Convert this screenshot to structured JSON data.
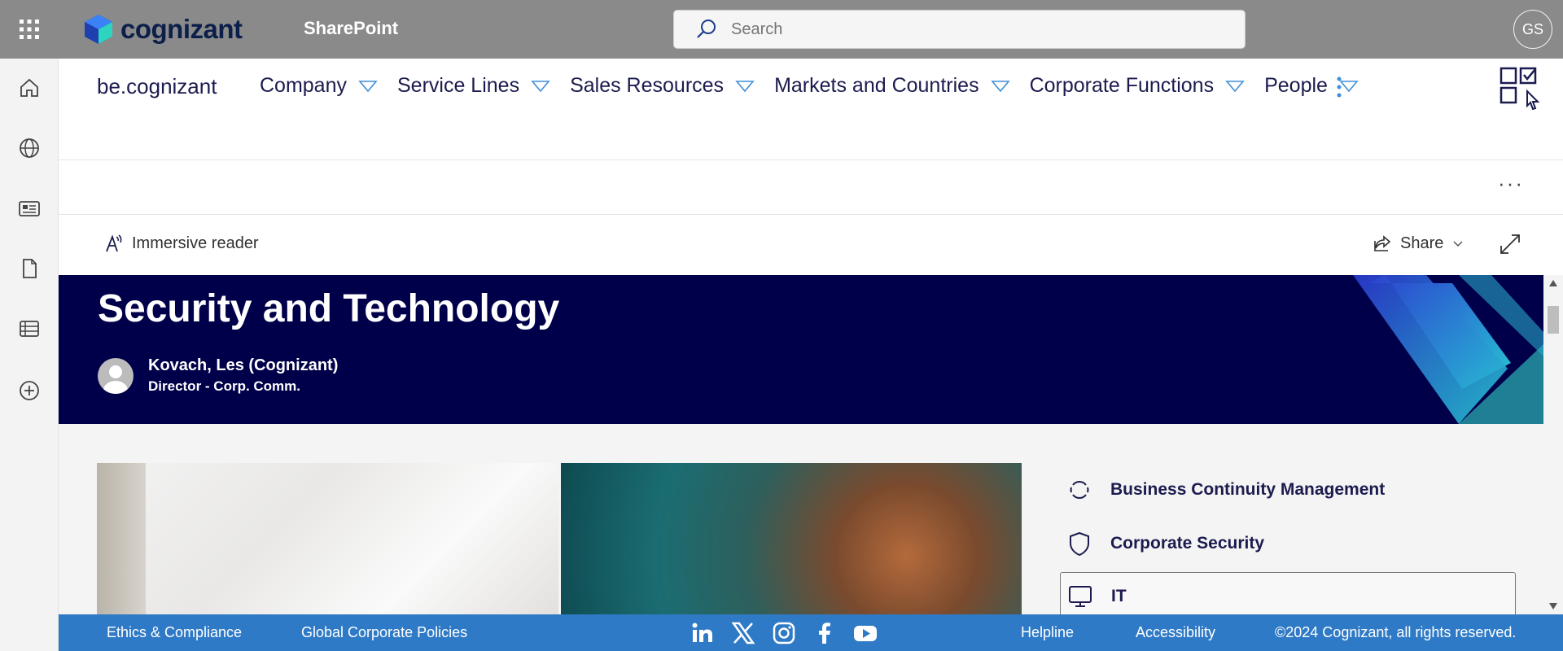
{
  "suitebar": {
    "brand": "cognizant",
    "app_name": "SharePoint",
    "search_placeholder": "Search",
    "user_initials": "GS"
  },
  "hubnav": {
    "site_title": "be.cognizant",
    "menu": [
      {
        "label": "Company"
      },
      {
        "label": "Service Lines"
      },
      {
        "label": "Sales Resources"
      },
      {
        "label": "Markets and Countries"
      },
      {
        "label": "Corporate Functions"
      },
      {
        "label": "People"
      }
    ]
  },
  "commandbar": {
    "overflow": "···"
  },
  "pagebar": {
    "immersive_reader": "Immersive reader",
    "share": "Share"
  },
  "banner": {
    "title": "Security and Technology",
    "author_name": "Kovach, Les (Cognizant)",
    "author_role": "Director - Corp. Comm."
  },
  "quicklinks": [
    {
      "label": "Business Continuity Management",
      "icon": "refresh-icon"
    },
    {
      "label": "Corporate Security",
      "icon": "shield-icon"
    },
    {
      "label": "IT",
      "icon": "monitor-icon"
    }
  ],
  "footer": {
    "ethics": "Ethics & Compliance",
    "policies": "Global Corporate Policies",
    "helpline": "Helpline",
    "accessibility": "Accessibility",
    "copyright": "©2024 Cognizant, all rights reserved.",
    "social": [
      "linkedin-icon",
      "x-icon",
      "instagram-icon",
      "facebook-icon",
      "youtube-icon"
    ]
  },
  "colors": {
    "suitebar": "#8a8a8a",
    "banner": "#00004a",
    "footer": "#2f7ac6",
    "text_navy": "#1b1b4f"
  }
}
